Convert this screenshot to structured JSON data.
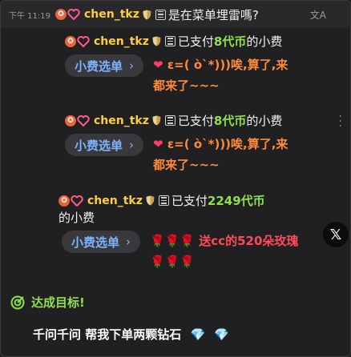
{
  "top_message": {
    "time": "下午 11:19",
    "user": "chen_tkz",
    "text": "是在菜单埋雷嗎?",
    "translate_icon": "translate-icon"
  },
  "tips": [
    {
      "user": "chen_tkz",
      "prefix": "已支付",
      "amount": "8代币",
      "suffix": "的小费",
      "menu_label": "小费选单",
      "gift": "ε=( ò`*)))唉,算了,来都来了~~~"
    },
    {
      "user": "chen_tkz",
      "prefix": "已支付",
      "amount": "8代币",
      "suffix": "的小费",
      "menu_label": "小费选单",
      "gift": "ε=( ò`*)))唉,算了,来都来了~~~"
    },
    {
      "user": "chen_tkz",
      "prefix": "已支付",
      "amount": "2249代币",
      "suffix": "的小费",
      "menu_label": "小费选单",
      "gift": "送cc的520朵玫瑰"
    }
  ],
  "goal": {
    "label": "达成目标!",
    "text": "千问千问 帮我下单两颗钻石"
  },
  "colors": {
    "username": "#ffcf3a",
    "amount": "#8fe04a",
    "menu": "#7eb3ff",
    "gift": "#ff8a3c"
  }
}
